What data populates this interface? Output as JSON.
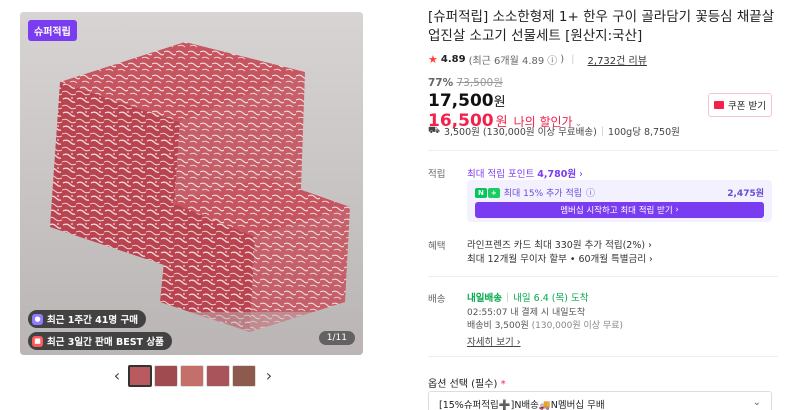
{
  "gallery": {
    "badge": "슈퍼적립",
    "pill_recent_purchase": "최근 1주간 41명 구매",
    "pill_best": "최근 3일간 판매 BEST 상품",
    "counter": "1/11"
  },
  "product": {
    "title": "[슈퍼적립] 소소한형제 1+ 한우 구이 골라담기 꽃등심 채끝살 업진살 소고기 선물세트 [원산지:국산]",
    "rating": "4.89",
    "rating_detail": "(최근 6개월 4.89",
    "rating_detail_close": ")",
    "review_count": "2,732건 리뷰",
    "discount_pct": "77%",
    "original_price": "73,500원",
    "price": "17,500",
    "price_unit": "원",
    "my_price": "16,500",
    "my_price_unit": "원",
    "my_price_label": "나의 할인가",
    "coupon_label": "쿠폰 받기",
    "shipping": "3,500원 (130,000원 이상 무료배송)",
    "unit_price": "100g당 8,750원"
  },
  "points": {
    "label": "적립",
    "max_point_text": "최대 적립 포인트",
    "max_point_value": "4,780원",
    "plus_logo": "N",
    "plus_tag": "+",
    "plus_text": "최대 15% 추가 적립",
    "plus_amount": "2,475원",
    "plus_cta": "멤버십 시작하고 최대 적립 받기"
  },
  "benefits": {
    "label": "혜택",
    "line1": "라인프렌즈 카드 최대 330원 추가 적립(2%)",
    "line2": "최대 12개월 무이자 할부 • 60개월 특별금리"
  },
  "delivery": {
    "label": "배송",
    "tag": "내일배송",
    "date": "내일 6.4 (목) 도착",
    "line1": "02:55:07  내 결제 시 내일도착",
    "line2": "배송비 3,500원",
    "line2_muted": "(130,000원 이상 무료)",
    "detail_link": "자세히 보기"
  },
  "option": {
    "label": "옵션 선택 (필수)",
    "required_mark": "*",
    "selected": "[15%슈퍼적립➕]N배송🚚N멤버십 무배"
  }
}
